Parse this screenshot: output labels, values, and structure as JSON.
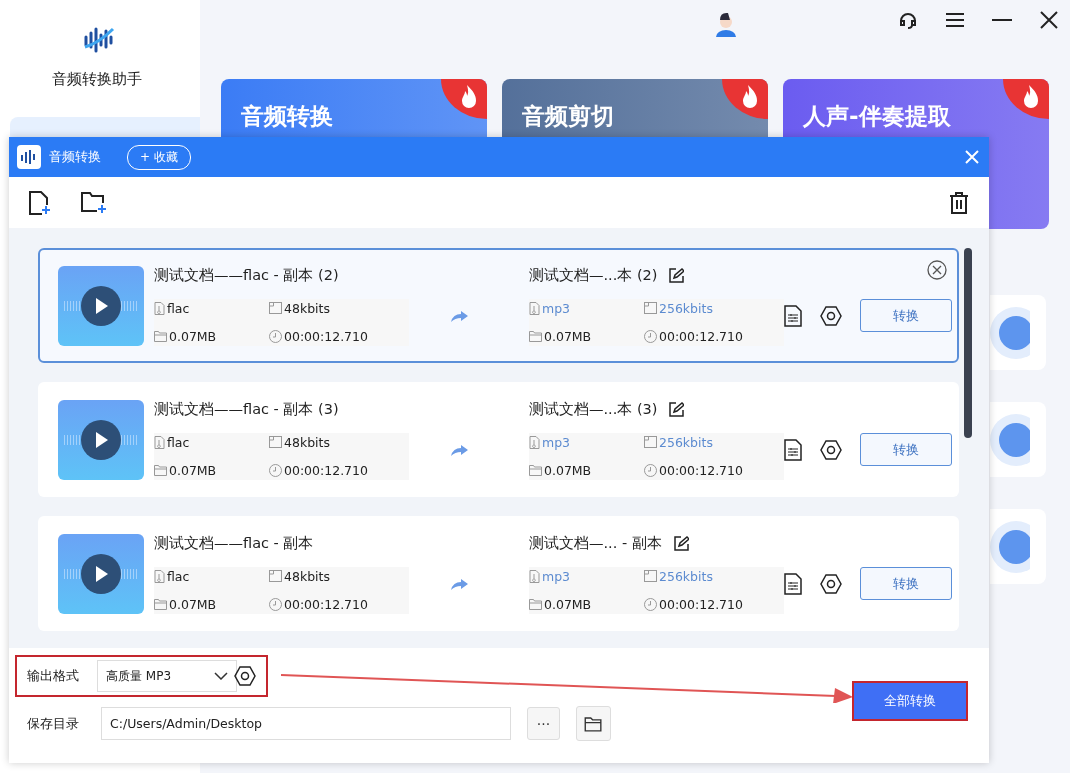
{
  "app": {
    "title": "音频转换助手"
  },
  "feature_cards": [
    {
      "title": "音频转换",
      "color": "#3b7cf5"
    },
    {
      "title": "音频剪切",
      "color": "#54709a"
    },
    {
      "title": "人声-伴奏提取",
      "color": "#6b5cf0"
    }
  ],
  "dialog": {
    "title": "音频转换",
    "favorite_button": "+ 收藏",
    "files": [
      {
        "name": "测试文档——flac - 副本 (2)",
        "format": "flac",
        "bitrate": "48kbits",
        "size": "0.07MB",
        "duration": "00:00:12.710",
        "output_name": "测试文档—...本 (2)",
        "output_format": "mp3",
        "output_bitrate": "256kbits",
        "output_size": "0.07MB",
        "output_duration": "00:00:12.710",
        "convert_button": "转换",
        "selected": true
      },
      {
        "name": "测试文档——flac - 副本 (3)",
        "format": "flac",
        "bitrate": "48kbits",
        "size": "0.07MB",
        "duration": "00:00:12.710",
        "output_name": "测试文档—...本 (3)",
        "output_format": "mp3",
        "output_bitrate": "256kbits",
        "output_size": "0.07MB",
        "output_duration": "00:00:12.710",
        "convert_button": "转换",
        "selected": false
      },
      {
        "name": "测试文档——flac - 副本",
        "format": "flac",
        "bitrate": "48kbits",
        "size": "0.07MB",
        "duration": "00:00:12.710",
        "output_name": "测试文档—... - 副本",
        "output_format": "mp3",
        "output_bitrate": "256kbits",
        "output_size": "0.07MB",
        "output_duration": "00:00:12.710",
        "convert_button": "转换",
        "selected": false
      }
    ],
    "output_format_label": "输出格式",
    "output_format_value": "高质量 MP3",
    "save_dir_label": "保存目录",
    "save_dir_value": "C:/Users/Admin/Desktop",
    "more_button": "···",
    "convert_all_button": "全部转换"
  }
}
